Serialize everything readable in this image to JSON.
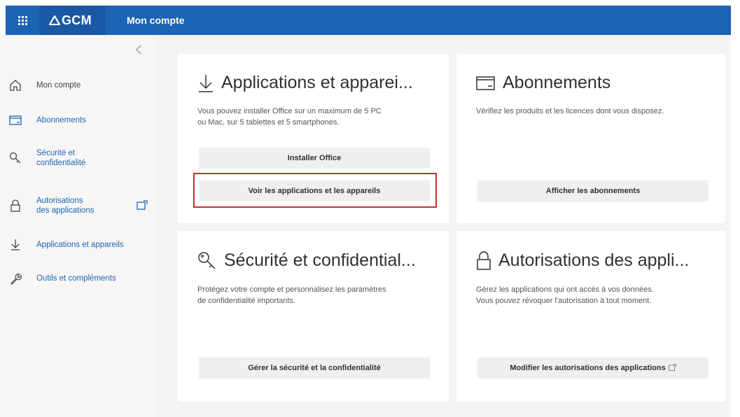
{
  "header": {
    "logo_text": "GCM",
    "app_title": "Mon compte",
    "brand_color": "#1d63b5"
  },
  "sidebar": {
    "collapse_icon": "chevron-left-icon",
    "items": [
      {
        "label": "Mon compte",
        "icon": "home-icon"
      },
      {
        "label": "Abonnements",
        "icon": "card-icon"
      },
      {
        "label_line1": "Sécurité et",
        "label_line2": "confidentialité",
        "icon": "key-icon"
      },
      {
        "label_line1": "Autorisations",
        "label_line2": "des applications",
        "icon": "lock-icon"
      },
      {
        "label": "Applications et appareils",
        "icon": "download-icon"
      },
      {
        "label": "Outils et compléments",
        "icon": "wrench-icon"
      }
    ]
  },
  "cards": {
    "apps": {
      "title": "Applications et apparei...",
      "desc_line1": "Vous pouvez installer Office sur un maximum de 5 PC",
      "desc_line2": "ou Mac, sur 5 tablettes et 5 smartphones.",
      "btn_install": "Installer Office",
      "btn_view": "Voir les applications et les appareils"
    },
    "subscriptions": {
      "title": "Abonnements",
      "desc": "Vérifiez les produits et les licences dont vous disposez.",
      "btn": "Afficher les abonnements"
    },
    "security": {
      "title": "Sécurité et confidential...",
      "desc_line1": "Protégez votre compte et personnalisez les paramètres",
      "desc_line2": "de confidentialité importants.",
      "btn": "Gérer la sécurité et la confidentialité"
    },
    "permissions": {
      "title": "Autorisations des appli...",
      "desc_line1": "Gérez les applications qui ont accès à vos données.",
      "desc_line2": "Vous pouvez révoquer l'autorisation à tout moment.",
      "btn": "Modifier les autorisations des applications"
    }
  },
  "highlight_color": "#c4302b"
}
